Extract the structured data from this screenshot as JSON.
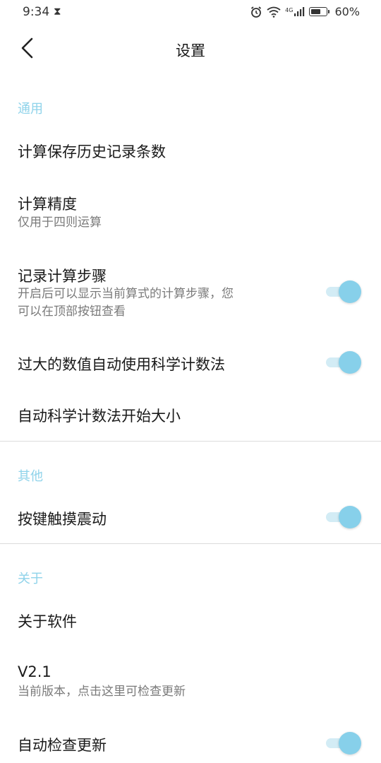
{
  "status_bar": {
    "time": "9:34",
    "hourglass_icon": "hourglass-icon",
    "network": "4G",
    "battery": "60%",
    "battery_level": 0.6
  },
  "header": {
    "title": "设置",
    "back_icon": "chevron-left-icon"
  },
  "sections": {
    "general": {
      "label": "通用",
      "history_count": {
        "title": "计算保存历史记录条数"
      },
      "precision": {
        "title": "计算精度",
        "subtitle": "仅用于四则运算"
      },
      "record_steps": {
        "title": "记录计算步骤",
        "subtitle_line1": "开启后可以显示当前算式的计算步骤，您",
        "subtitle_line2": "可以在顶部按钮查看",
        "enabled": true
      },
      "auto_scientific": {
        "title": "过大的数值自动使用科学计数法",
        "enabled": true
      },
      "scientific_threshold": {
        "title": "自动科学计数法开始大小"
      }
    },
    "other": {
      "label": "其他",
      "haptic": {
        "title": "按键触摸震动",
        "enabled": true
      }
    },
    "about": {
      "label": "关于",
      "about_app": {
        "title": "关于软件"
      },
      "version": {
        "title": "V2.1",
        "subtitle": "当前版本，点击这里可检查更新"
      },
      "auto_update": {
        "title": "自动检查更新",
        "enabled": true
      }
    }
  },
  "colors": {
    "accent": "#87d0ea",
    "accent_track": "#d3ecf5",
    "section_header": "#8fd3ea",
    "divider": "#dcdcdc"
  }
}
